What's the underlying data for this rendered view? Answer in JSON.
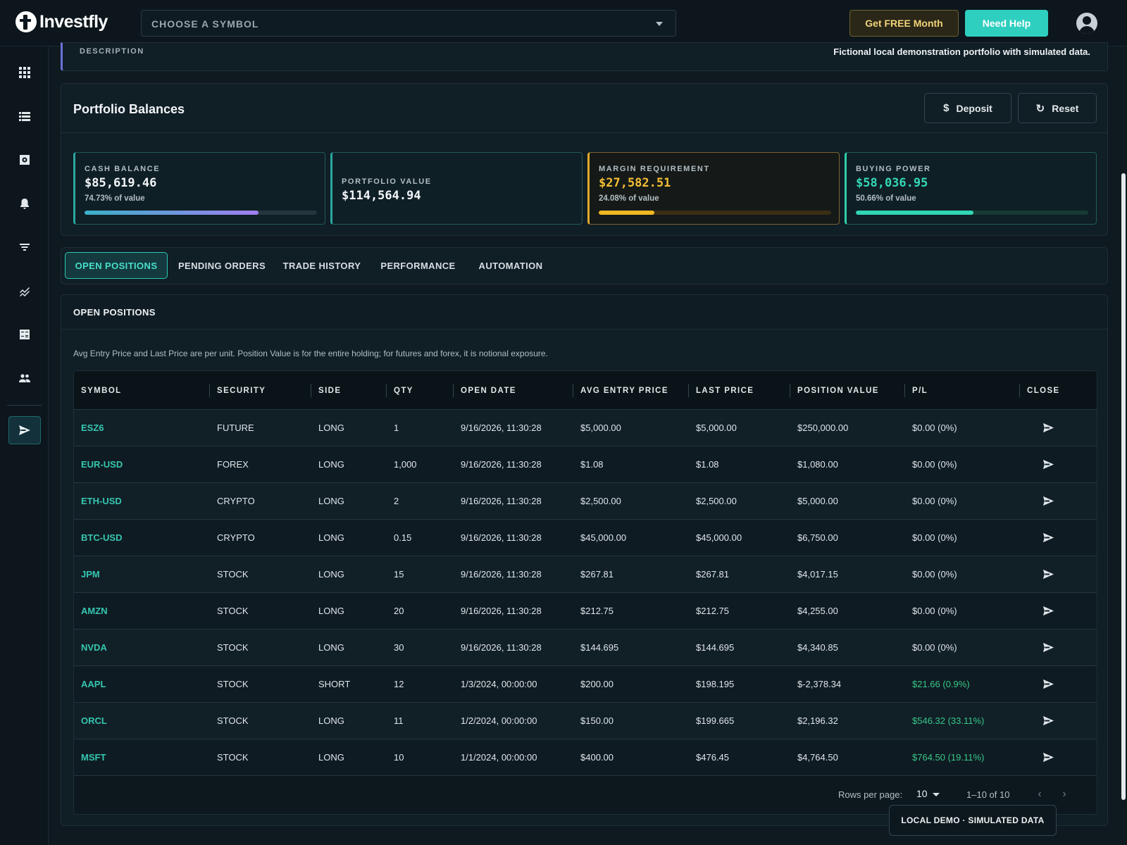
{
  "header": {
    "brand": "Investfly",
    "symbol_placeholder": "CHOOSE A SYMBOL",
    "free_month_label": "Get FREE Month",
    "help_label": "Need Help"
  },
  "sidebar": {
    "items": [
      {
        "icon": "grid-icon"
      },
      {
        "icon": "list-icon"
      },
      {
        "icon": "gear-box-icon"
      },
      {
        "icon": "bell-icon"
      },
      {
        "icon": "filter-icon"
      },
      {
        "icon": "chart-lines-icon"
      },
      {
        "icon": "calculator-icon"
      },
      {
        "icon": "people-icon"
      },
      {
        "icon": "send-icon"
      }
    ]
  },
  "description": {
    "label": "DESCRIPTION",
    "text": "Fictional local demonstration portfolio with simulated data."
  },
  "balances": {
    "title": "Portfolio Balances",
    "deposit_label": "Deposit",
    "reset_label": "Reset",
    "cash": {
      "label": "CASH BALANCE",
      "value": "$85,619.46",
      "pct": "74.73% of value",
      "fill": 0.7473
    },
    "portfolio": {
      "label": "PORTFOLIO VALUE",
      "value": "$114,564.94"
    },
    "margin": {
      "label": "MARGIN REQUIREMENT",
      "value": "$27,582.51",
      "pct": "24.08% of value",
      "fill": 0.2408
    },
    "buying": {
      "label": "BUYING POWER",
      "value": "$58,036.95",
      "pct": "50.66% of value",
      "fill": 0.5066
    }
  },
  "tabs": [
    {
      "label": "OPEN POSITIONS",
      "active": true
    },
    {
      "label": "PENDING ORDERS"
    },
    {
      "label": "TRADE HISTORY"
    },
    {
      "label": "PERFORMANCE"
    },
    {
      "label": "AUTOMATION"
    }
  ],
  "positions": {
    "title": "OPEN POSITIONS",
    "note": "Avg Entry Price and Last Price are per unit. Position Value is for the entire holding; for futures and forex, it is notional exposure.",
    "columns": [
      "SYMBOL",
      "SECURITY",
      "SIDE",
      "QTY",
      "OPEN DATE",
      "AVG ENTRY PRICE",
      "LAST PRICE",
      "POSITION VALUE",
      "P/L",
      "CLOSE"
    ],
    "rows": [
      {
        "symbol": "ESZ6",
        "security": "FUTURE",
        "side": "LONG",
        "qty": "1",
        "open_date": "9/16/2026, 11:30:28",
        "avg_entry": "$5,000.00",
        "last": "$5,000.00",
        "value": "$250,000.00",
        "pl": "$0.00 (0%)",
        "pl_positive": false
      },
      {
        "symbol": "EUR-USD",
        "security": "FOREX",
        "side": "LONG",
        "qty": "1,000",
        "open_date": "9/16/2026, 11:30:28",
        "avg_entry": "$1.08",
        "last": "$1.08",
        "value": "$1,080.00",
        "pl": "$0.00 (0%)",
        "pl_positive": false
      },
      {
        "symbol": "ETH-USD",
        "security": "CRYPTO",
        "side": "LONG",
        "qty": "2",
        "open_date": "9/16/2026, 11:30:28",
        "avg_entry": "$2,500.00",
        "last": "$2,500.00",
        "value": "$5,000.00",
        "pl": "$0.00 (0%)",
        "pl_positive": false
      },
      {
        "symbol": "BTC-USD",
        "security": "CRYPTO",
        "side": "LONG",
        "qty": "0.15",
        "open_date": "9/16/2026, 11:30:28",
        "avg_entry": "$45,000.00",
        "last": "$45,000.00",
        "value": "$6,750.00",
        "pl": "$0.00 (0%)",
        "pl_positive": false
      },
      {
        "symbol": "JPM",
        "security": "STOCK",
        "side": "LONG",
        "qty": "15",
        "open_date": "9/16/2026, 11:30:28",
        "avg_entry": "$267.81",
        "last": "$267.81",
        "value": "$4,017.15",
        "pl": "$0.00 (0%)",
        "pl_positive": false
      },
      {
        "symbol": "AMZN",
        "security": "STOCK",
        "side": "LONG",
        "qty": "20",
        "open_date": "9/16/2026, 11:30:28",
        "avg_entry": "$212.75",
        "last": "$212.75",
        "value": "$4,255.00",
        "pl": "$0.00 (0%)",
        "pl_positive": false
      },
      {
        "symbol": "NVDA",
        "security": "STOCK",
        "side": "LONG",
        "qty": "30",
        "open_date": "9/16/2026, 11:30:28",
        "avg_entry": "$144.695",
        "last": "$144.695",
        "value": "$4,340.85",
        "pl": "$0.00 (0%)",
        "pl_positive": false
      },
      {
        "symbol": "AAPL",
        "security": "STOCK",
        "side": "SHORT",
        "qty": "12",
        "open_date": "1/3/2024, 00:00:00",
        "avg_entry": "$200.00",
        "last": "$198.195",
        "value": "$-2,378.34",
        "pl": "$21.66 (0.9%)",
        "pl_positive": true
      },
      {
        "symbol": "ORCL",
        "security": "STOCK",
        "side": "LONG",
        "qty": "11",
        "open_date": "1/2/2024, 00:00:00",
        "avg_entry": "$150.00",
        "last": "$199.665",
        "value": "$2,196.32",
        "pl": "$546.32 (33.11%)",
        "pl_positive": true
      },
      {
        "symbol": "MSFT",
        "security": "STOCK",
        "side": "LONG",
        "qty": "10",
        "open_date": "1/1/2024, 00:00:00",
        "avg_entry": "$400.00",
        "last": "$476.45",
        "value": "$4,764.50",
        "pl": "$764.50 (19.11%)",
        "pl_positive": true
      }
    ],
    "rows_per_page_label": "Rows per page:",
    "rows_per_page": "10",
    "range": "1–10 of 10"
  },
  "toast": "LOCAL DEMO · SIMULATED DATA",
  "colors": {
    "accent": "#2fcfc0",
    "positive": "#37c98a",
    "warning": "#f0b723",
    "symbol_link": "#35c7b0"
  }
}
